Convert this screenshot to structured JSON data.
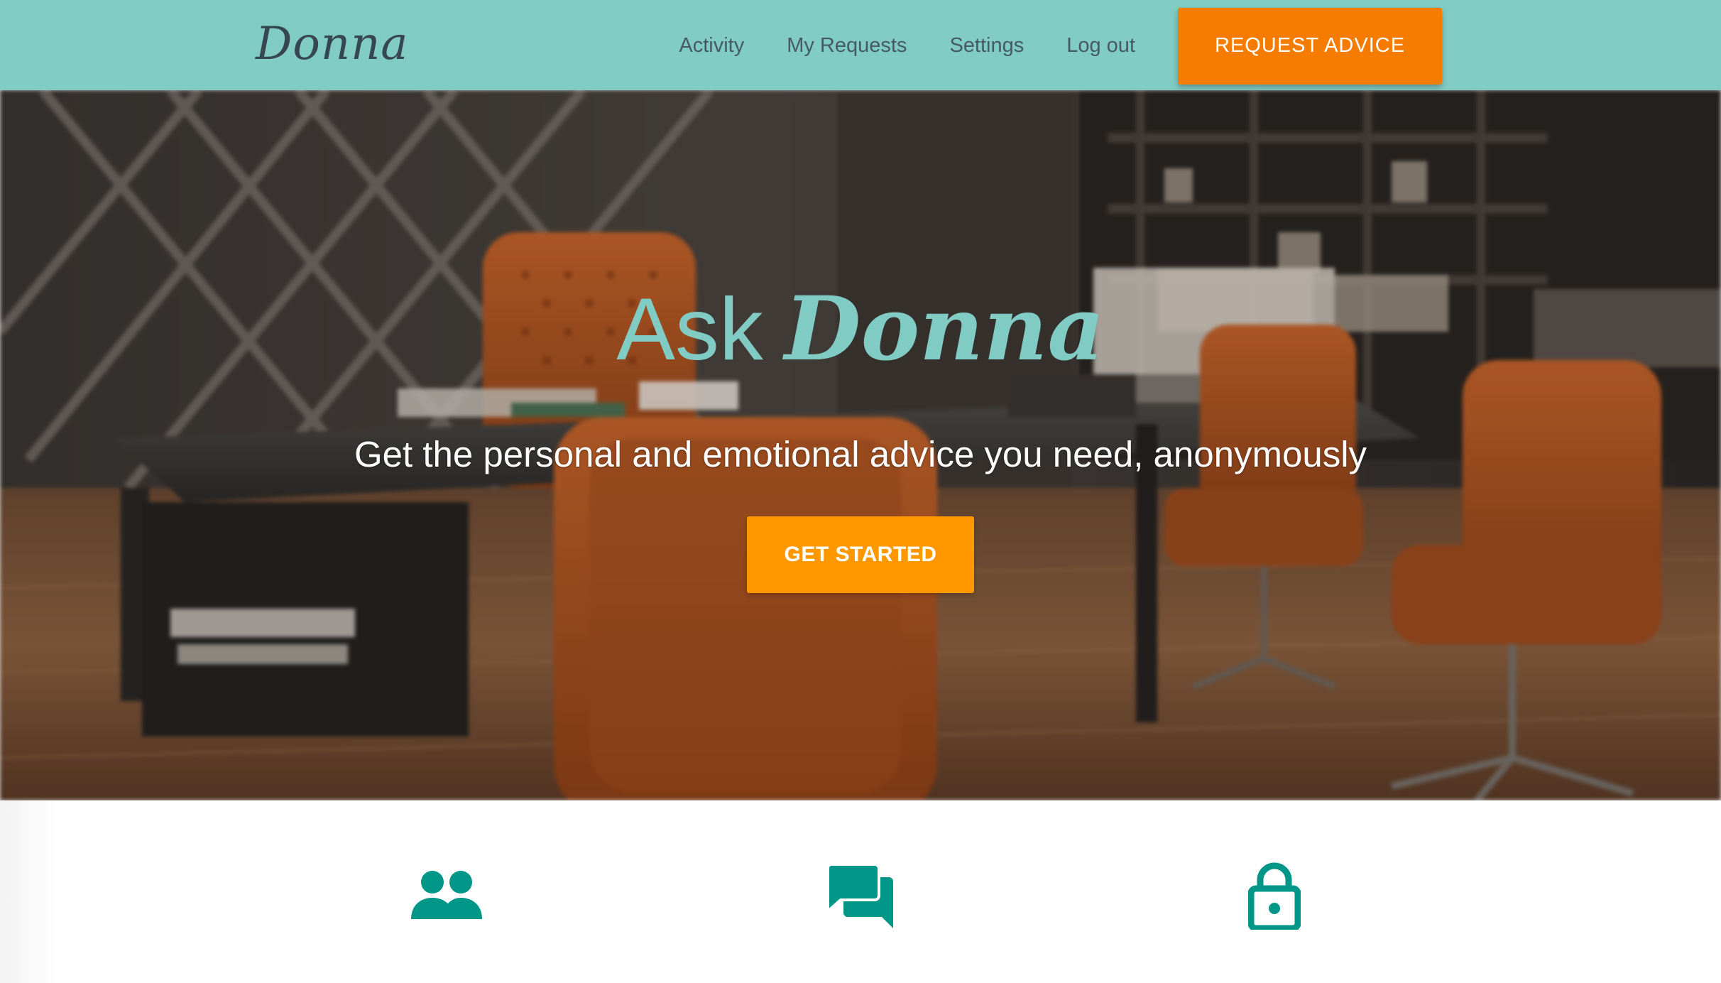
{
  "header": {
    "brand": "Donna",
    "nav": [
      {
        "label": "Activity"
      },
      {
        "label": "My Requests"
      },
      {
        "label": "Settings"
      },
      {
        "label": "Log out"
      }
    ],
    "cta_label": "REQUEST ADVICE"
  },
  "hero": {
    "title_prefix": "Ask",
    "title_brand": "Donna",
    "subtitle": "Get the personal and emotional advice you need, anonymously",
    "cta_label": "GET STARTED"
  },
  "features": {
    "icons": [
      "people-icon",
      "chat-icon",
      "lock-icon"
    ]
  },
  "colors": {
    "header_bg": "#80cbc4",
    "accent_orange": "#f57c00",
    "button_orange": "#ff9800",
    "teal_icon": "#009688",
    "brand_text": "#37474f"
  }
}
